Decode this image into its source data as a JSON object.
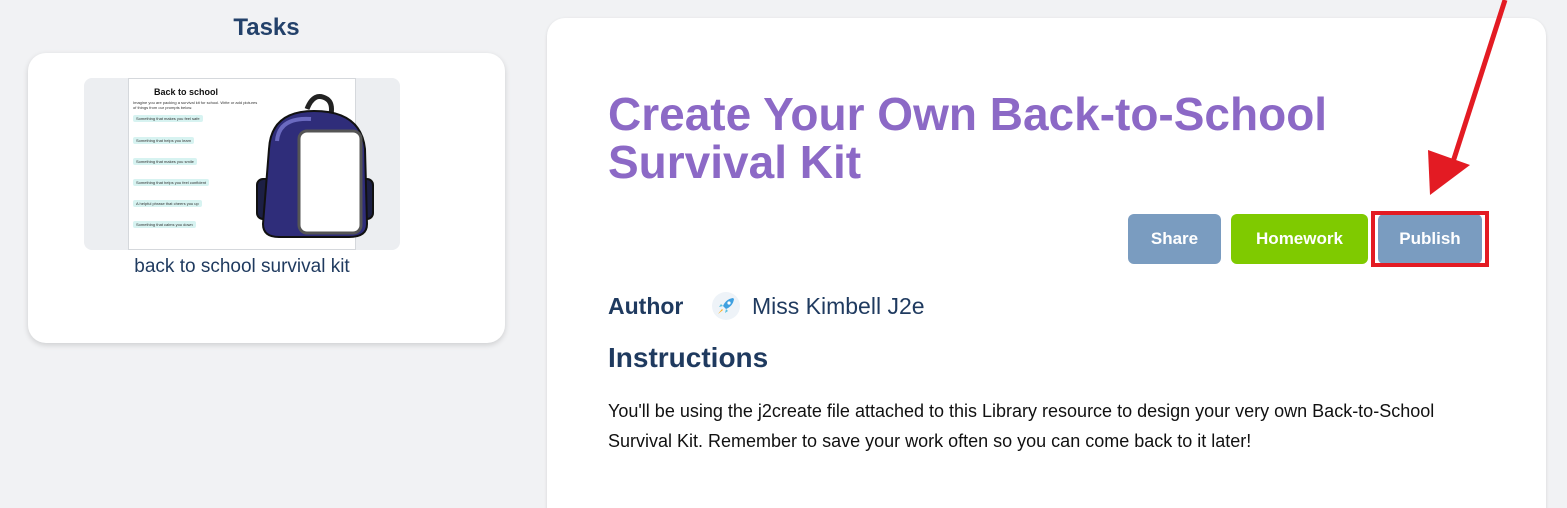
{
  "tasks": {
    "heading": "Tasks",
    "items": [
      {
        "label": "back to school survival kit",
        "thumbnail": {
          "title": "Back to school",
          "subtitle": "Imagine you are packing a survival kit for school. Write or add pictures of things from our prompts below.",
          "prompts": [
            "Something that makes you feel safe",
            "Something that helps you learn",
            "Something that makes you smile",
            "Something that helps you feel confident",
            "A helpful phrase that cheers you up",
            "Something that calms you down"
          ]
        }
      }
    ]
  },
  "resource": {
    "title": "Create Your Own Back-to-School Survival Kit",
    "buttons": {
      "share": "Share",
      "homework": "Homework",
      "publish": "Publish"
    },
    "author_label": "Author",
    "author_name": "Miss Kimbell J2e",
    "instructions_heading": "Instructions",
    "instructions_text": " You'll be using the j2create file attached to this Library resource to design your very own Back-to-School Survival Kit. Remember to save your work often so you can come back to it later!"
  },
  "colors": {
    "title_purple": "#8c69c6",
    "share_blue": "#7a9cc0",
    "homework_green": "#7fca00",
    "highlight_red": "#e31b23"
  },
  "icons": {
    "author_avatar": "rocket-icon"
  }
}
